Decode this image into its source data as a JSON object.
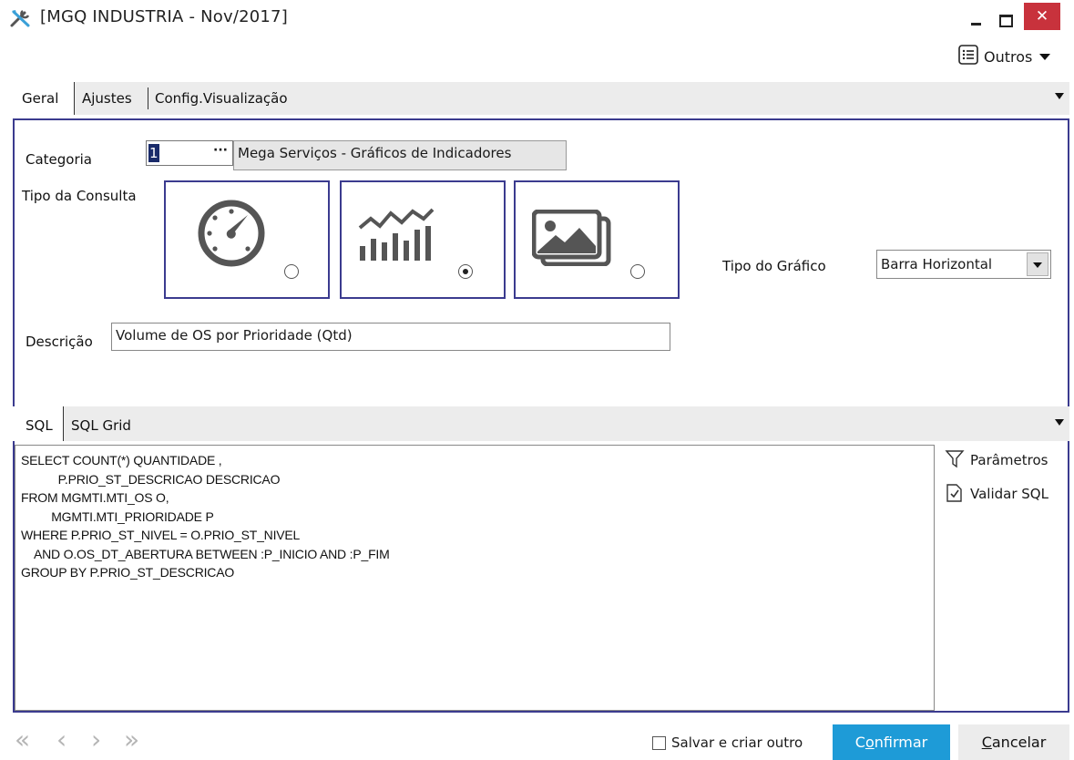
{
  "window": {
    "title": "[MGQ INDUSTRIA - Nov/2017]",
    "close_glyph": "✕"
  },
  "toolbar": {
    "outros_label": "Outros"
  },
  "tabs": {
    "geral": "Geral",
    "ajustes": "Ajustes",
    "config": "Config.Visualização"
  },
  "form": {
    "categoria_label": "Categoria",
    "categoria_value": "1",
    "categoria_button": "···",
    "categoria_desc": "Mega Serviços - Gráficos de Indicadores",
    "tipo_consulta_label": "Tipo da Consulta",
    "tipo_consulta_options": [
      {
        "icon": "gauge-icon",
        "selected": false
      },
      {
        "icon": "chart-icon",
        "selected": true
      },
      {
        "icon": "image-icon",
        "selected": false
      }
    ],
    "tipo_grafico_label": "Tipo do Gráfico",
    "tipo_grafico_value": "Barra Horizontal",
    "descricao_label": "Descrição",
    "descricao_value": "Volume de OS por Prioridade (Qtd)"
  },
  "sql_tabs": {
    "sql": "SQL",
    "sql_grid": "SQL Grid"
  },
  "sql": {
    "lines": [
      "SELECT COUNT(*) QUANTIDADE ,",
      "           P.PRIO_ST_DESCRICAO DESCRICAO",
      "FROM MGMTI.MTI_OS O,",
      "         MGMTI.MTI_PRIORIDADE P",
      "WHERE P.PRIO_ST_NIVEL = O.PRIO_ST_NIVEL",
      "    AND O.OS_DT_ABERTURA BETWEEN :P_INICIO AND :P_FIM",
      "GROUP BY P.PRIO_ST_DESCRICAO"
    ]
  },
  "side_actions": {
    "parametros": "Parâmetros",
    "validar": "Validar SQL"
  },
  "footer": {
    "nav_first": "«",
    "nav_prev": "‹",
    "nav_next": "›",
    "nav_last": "»",
    "salvar_label": "Salvar e criar outro",
    "confirmar_prefix": "C",
    "confirmar_underlined": "o",
    "confirmar_rest": "nfirmar",
    "cancelar_underlined": "C",
    "cancelar_rest": "ancelar"
  },
  "colors": {
    "accent_border": "#3b3b8f",
    "confirm_button": "#1e9bd7",
    "close_button": "#c8323c"
  }
}
